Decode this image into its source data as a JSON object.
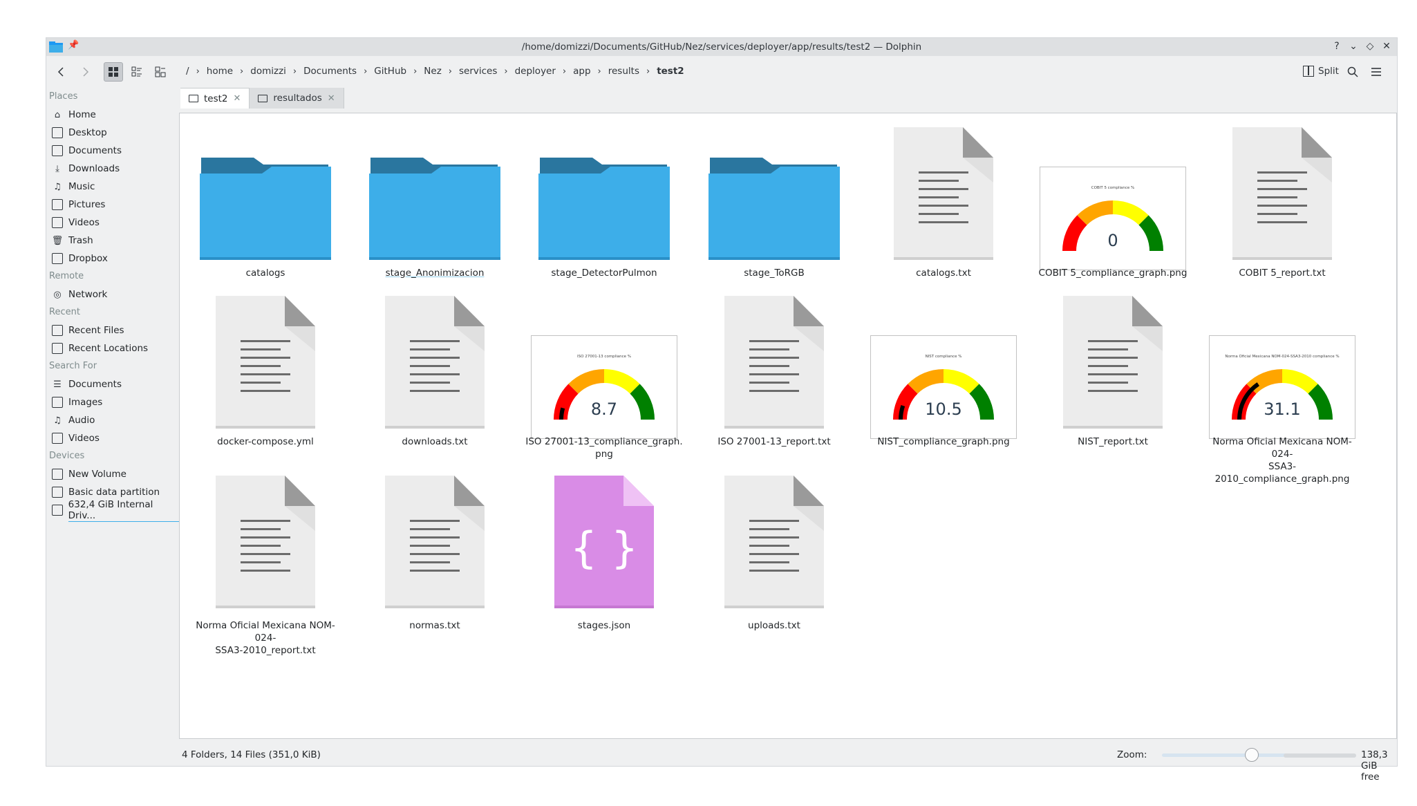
{
  "window": {
    "title": "/home/domizzi/Documents/GitHub/Nez/services/deployer/app/results/test2 — Dolphin",
    "controls": [
      "?",
      "⌄",
      "◇",
      "✕"
    ]
  },
  "toolbar": {
    "breadcrumbs": [
      "/",
      "home",
      "domizzi",
      "Documents",
      "GitHub",
      "Nez",
      "services",
      "deployer",
      "app",
      "results",
      "test2"
    ],
    "split_label": "Split"
  },
  "sidebar": {
    "places_header": "Places",
    "places": [
      {
        "label": "Home",
        "icon": "home-icon"
      },
      {
        "label": "Desktop",
        "icon": "desktop-icon"
      },
      {
        "label": "Documents",
        "icon": "documents-icon"
      },
      {
        "label": "Downloads",
        "icon": "downloads-icon"
      },
      {
        "label": "Music",
        "icon": "music-icon"
      },
      {
        "label": "Pictures",
        "icon": "pictures-icon"
      },
      {
        "label": "Videos",
        "icon": "videos-icon"
      },
      {
        "label": "Trash",
        "icon": "trash-icon"
      },
      {
        "label": "Dropbox",
        "icon": "dropbox-icon"
      }
    ],
    "remote_header": "Remote",
    "remote": [
      {
        "label": "Network",
        "icon": "network-icon"
      }
    ],
    "recent_header": "Recent",
    "recent": [
      {
        "label": "Recent Files",
        "icon": "recent-files-icon"
      },
      {
        "label": "Recent Locations",
        "icon": "recent-locations-icon"
      }
    ],
    "search_header": "Search For",
    "search": [
      {
        "label": "Documents",
        "icon": "search-documents-icon"
      },
      {
        "label": "Images",
        "icon": "search-images-icon"
      },
      {
        "label": "Audio",
        "icon": "search-audio-icon"
      },
      {
        "label": "Videos",
        "icon": "search-videos-icon"
      }
    ],
    "devices_header": "Devices",
    "devices": [
      {
        "label": "New Volume",
        "icon": "drive-icon"
      },
      {
        "label": "Basic data partition",
        "icon": "drive-icon"
      },
      {
        "label": "632,4 GiB Internal Driv...",
        "icon": "drive-icon"
      }
    ]
  },
  "tabs": [
    {
      "label": "test2",
      "active": true
    },
    {
      "label": "resultados",
      "active": false
    }
  ],
  "items": [
    {
      "name": "catalogs",
      "type": "folder"
    },
    {
      "name": "stage_Anonimizacion",
      "type": "folder"
    },
    {
      "name": "stage_DetectorPulmon",
      "type": "folder"
    },
    {
      "name": "stage_ToRGB",
      "type": "folder"
    },
    {
      "name": "catalogs.txt",
      "type": "text"
    },
    {
      "name": "COBIT 5_compliance_graph.png",
      "type": "gauge",
      "gauge_title": "COBIT 5 compliance %",
      "gauge_value": "0"
    },
    {
      "name": "COBIT 5_report.txt",
      "type": "text"
    },
    {
      "name": "docker-compose.yml",
      "type": "text"
    },
    {
      "name": "downloads.txt",
      "type": "text"
    },
    {
      "name": "ISO 27001-13_compliance_graph.png",
      "type": "gauge",
      "gauge_title": "ISO 27001-13 compliance %",
      "gauge_value": "8.7"
    },
    {
      "name": "ISO 27001-13_report.txt",
      "type": "text"
    },
    {
      "name": "NIST_compliance_graph.png",
      "type": "gauge",
      "gauge_title": "NIST compliance %",
      "gauge_value": "10.5"
    },
    {
      "name": "NIST_report.txt",
      "type": "text"
    },
    {
      "name": "Norma Oficial Mexicana NOM-024-SSA3-2010_compliance_graph.png",
      "type": "gauge",
      "gauge_title": "Norma Oficial Mexicana NOM-024-SSA3-2010 compliance %",
      "gauge_value": "31.1"
    },
    {
      "name": "Norma Oficial Mexicana NOM-024-SSA3-2010_report.txt",
      "type": "text"
    },
    {
      "name": "normas.txt",
      "type": "text"
    },
    {
      "name": "stages.json",
      "type": "json"
    },
    {
      "name": "uploads.txt",
      "type": "text"
    }
  ],
  "status": {
    "summary": "4 Folders, 14 Files (351,0 KiB)",
    "zoom_label": "Zoom:",
    "free_space": "138,3 GiB free"
  },
  "colors": {
    "folder_front": "#3daee9",
    "folder_back": "#2a769f",
    "json_file": "#d98ce6",
    "gauge_red": "#ff0000",
    "gauge_orange": "#ffa500",
    "gauge_yellow": "#ffff00",
    "gauge_green": "#008000"
  }
}
